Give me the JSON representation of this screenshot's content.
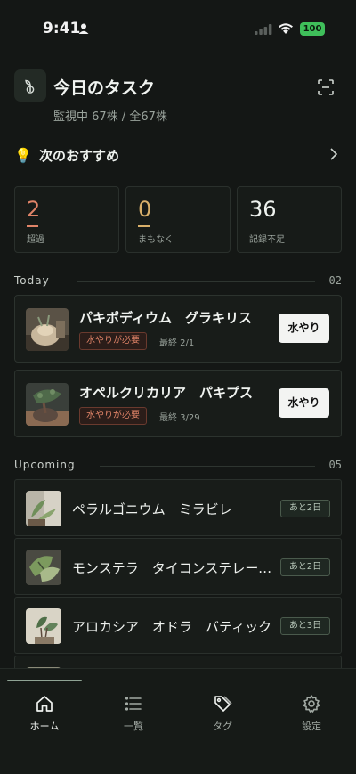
{
  "status_bar": {
    "time": "9:41",
    "battery": "100"
  },
  "header": {
    "title": "今日のタスク",
    "subtitle": "監視中 67株 / 全67株"
  },
  "recommend": {
    "label": "次のおすすめ"
  },
  "stats": [
    {
      "value": "2",
      "label": "超過",
      "color": "#e08468"
    },
    {
      "value": "0",
      "label": "まもなく",
      "color": "#d9b06a"
    },
    {
      "value": "36",
      "label": "記録不足",
      "color": "#eef2ee"
    }
  ],
  "today": {
    "title": "Today",
    "count": "02",
    "items": [
      {
        "name": "パキポディウム　グラキリス",
        "badge": "水やりが必要",
        "last": "最終 2/1",
        "button": "水やり"
      },
      {
        "name": "オペルクリカリア　パキプス",
        "badge": "水やりが必要",
        "last": "最終 3/29",
        "button": "水やり"
      }
    ]
  },
  "upcoming": {
    "title": "Upcoming",
    "count": "05",
    "items": [
      {
        "name": "ペラルゴニウム　ミラビレ",
        "badge": "あと2日"
      },
      {
        "name": "モンステラ　タイコンステレーション",
        "badge": "あと2日"
      },
      {
        "name": "アロカシア　オドラ　バティック",
        "badge": "あと3日"
      }
    ]
  },
  "tabs": [
    {
      "label": "ホーム",
      "icon": "home-icon"
    },
    {
      "label": "一覧",
      "icon": "list-icon"
    },
    {
      "label": "タグ",
      "icon": "tag-icon"
    },
    {
      "label": "設定",
      "icon": "gear-icon"
    }
  ]
}
